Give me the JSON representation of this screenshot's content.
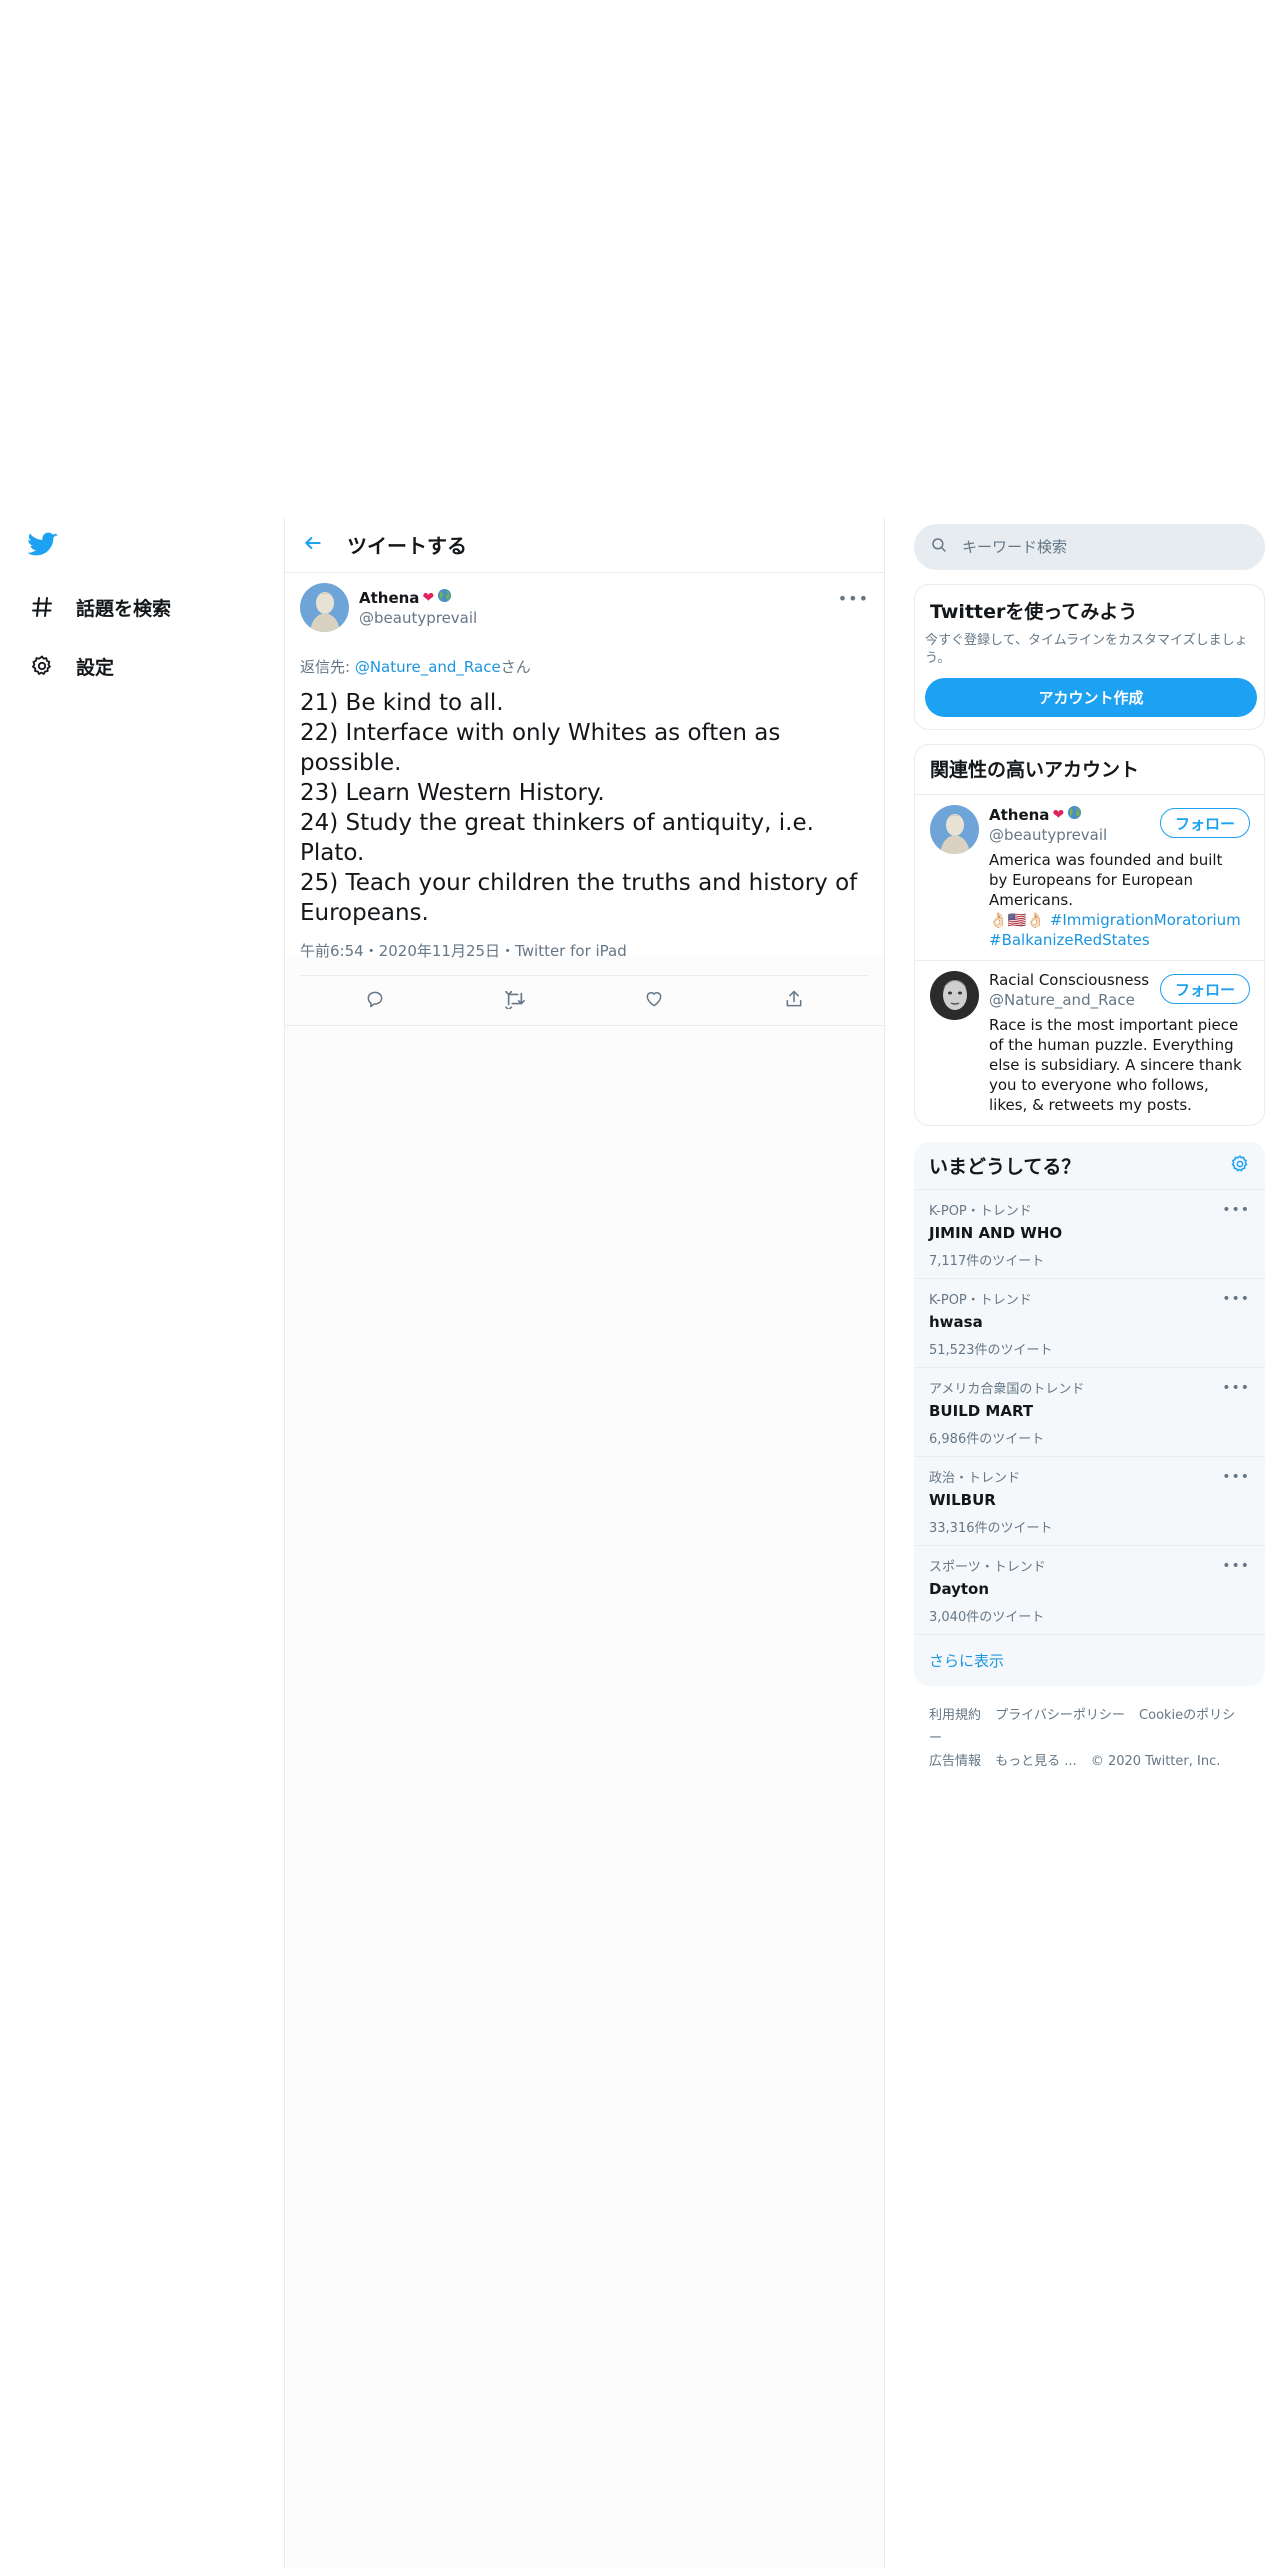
{
  "nav": {
    "explore_label": "話題を検索",
    "settings_label": "設定"
  },
  "header": {
    "title": "ツイートする"
  },
  "tweet": {
    "display_name": "Athena",
    "handle": "@beautyprevail",
    "reply_prefix": "返信先: ",
    "reply_mention": "@Nature_and_Race",
    "reply_suffix": "さん",
    "lines": [
      "21) Be kind to all.",
      "22) Interface with only Whites as often as possible.",
      "23) Learn Western History.",
      "24) Study the great thinkers of antiquity, i.e. Plato.",
      "25) Teach your children the truths and history of Europeans."
    ],
    "time": "午前6:54",
    "date": "2020年11月25日",
    "source": "Twitter for iPad",
    "separator": "・"
  },
  "search": {
    "placeholder": "キーワード検索"
  },
  "signup": {
    "title": "Twitterを使ってみよう",
    "desc": "今すぐ登録して、タイムラインをカスタマイズしましょう。",
    "button": "アカウント作成"
  },
  "related": {
    "title": "関連性の高いアカウント",
    "follow_label": "フォロー",
    "accounts": [
      {
        "name": "Athena",
        "handle": "@beautyprevail",
        "bio": "America was founded and built by Europeans for European Americans.",
        "bio_emoji": "👌🏻🇺🇸👌🏻",
        "tags": [
          "#ImmigrationMoratorium",
          "#BalkanizeRedStates"
        ]
      },
      {
        "name": "Racial Consciousness",
        "handle": "@Nature_and_Race",
        "bio": "Race is the most important piece of the human puzzle. Everything else is subsidiary. A sincere thank you to everyone who follows, likes, & retweets my posts."
      }
    ]
  },
  "trends": {
    "title": "いまどうしてる？",
    "items": [
      {
        "context": "K-POP・トレンド",
        "name": "JIMIN AND WHO",
        "count": "7,117件のツイート"
      },
      {
        "context": "K-POP・トレンド",
        "name": "hwasa",
        "count": "51,523件のツイート"
      },
      {
        "context": "アメリカ合衆国のトレンド",
        "name": "BUILD MART",
        "count": "6,986件のツイート"
      },
      {
        "context": "政治・トレンド",
        "name": "WILBUR",
        "count": "33,316件のツイート"
      },
      {
        "context": "スポーツ・トレンド",
        "name": "Dayton",
        "count": "3,040件のツイート"
      }
    ],
    "show_more": "さらに表示"
  },
  "footer": {
    "links": [
      "利用規約",
      "プライバシーポリシー",
      "Cookieのポリシー",
      "広告情報",
      "もっと見る ..."
    ],
    "copyright": "© 2020 Twitter, Inc."
  },
  "colors": {
    "accent": "#1da1f2",
    "link": "#1b95e0",
    "muted": "#657786",
    "border": "#e6ecf0"
  }
}
